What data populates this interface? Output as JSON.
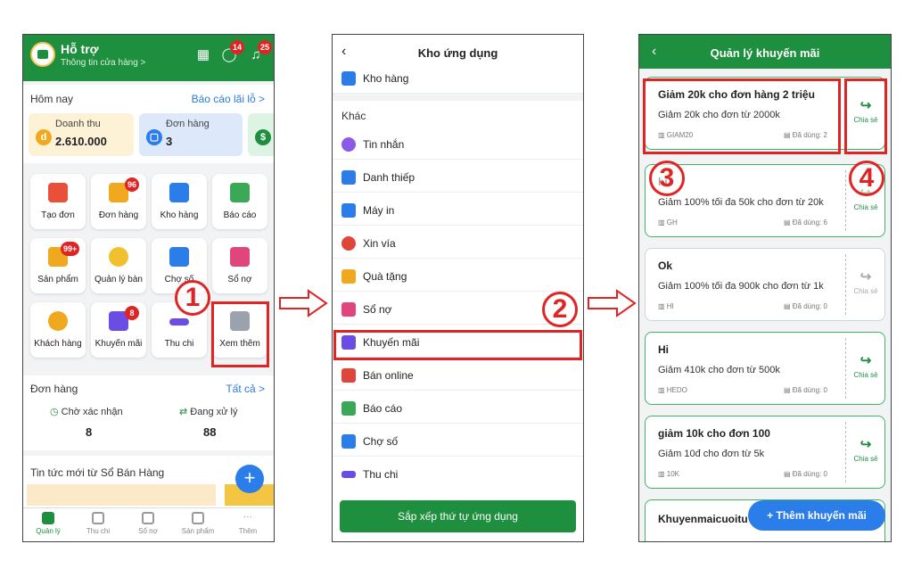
{
  "screen1": {
    "header": {
      "title": "Hỗ trợ",
      "subtitle": "Thông tin cửa hàng >",
      "badge_chat": "14",
      "badge_bell": "25"
    },
    "today": {
      "title": "Hôm nay",
      "report_link": "Báo cáo lãi lỗ >",
      "revenue_label": "Doanh thu",
      "revenue_value": "2.610.000",
      "orders_label": "Đơn hàng",
      "orders_value": "3"
    },
    "tiles": [
      {
        "label": "Tạo đơn",
        "badge": ""
      },
      {
        "label": "Đơn hàng",
        "badge": "96"
      },
      {
        "label": "Kho hàng",
        "badge": ""
      },
      {
        "label": "Báo cáo",
        "badge": ""
      },
      {
        "label": "Sản phẩm",
        "badge": "99+"
      },
      {
        "label": "Quản lý bàn",
        "badge": ""
      },
      {
        "label": "Chợ số",
        "badge": ""
      },
      {
        "label": "Sổ nợ",
        "badge": ""
      },
      {
        "label": "Khách hàng",
        "badge": ""
      },
      {
        "label": "Khuyến mãi",
        "badge": "8"
      },
      {
        "label": "Thu chi",
        "badge": ""
      },
      {
        "label": "Xem thêm",
        "badge": ""
      }
    ],
    "orders": {
      "title": "Đơn hàng",
      "all_link": "Tất cả >",
      "pending_label": "Chờ xác nhận",
      "pending_value": "8",
      "processing_label": "Đang xử lý",
      "processing_value": "88"
    },
    "news": {
      "title": "Tin tức mới từ Sổ Bán Hàng"
    },
    "nav": [
      "Quản lý",
      "Thu chi",
      "Sổ nợ",
      "Sản phẩm",
      "Thêm"
    ]
  },
  "screen2": {
    "title": "Kho ứng dụng",
    "top_item": "Kho hàng",
    "section": "Khác",
    "items": [
      "Tin nhắn",
      "Danh thiếp",
      "Máy in",
      "Xin vía",
      "Quà tặng",
      "Sổ nợ",
      "Khuyến mãi",
      "Bán online",
      "Báo cáo",
      "Chợ số",
      "Thu chi"
    ],
    "button": "Sắp xếp thứ tự ứng dụng"
  },
  "screen3": {
    "title": "Quản lý khuyến mãi",
    "share_label": "Chia sẻ",
    "coupons": [
      {
        "title": "Giảm 20k cho đơn hàng 2 triệu",
        "desc": "Giảm 20k cho đơn từ 2000k",
        "code": "GIAM20",
        "used": "Đã dùng: 2"
      },
      {
        "title": "hi",
        "desc": "Giảm 100% tối đa 50k cho đơn từ 20k",
        "code": "GH",
        "used": "Đã dùng: 6"
      },
      {
        "title": "Ok",
        "desc": "Giảm 100% tối đa 900k cho đơn từ 1k",
        "code": "HI",
        "used": "Đã dùng: 0"
      },
      {
        "title": "Hi",
        "desc": "Giảm 410k cho đơn từ 500k",
        "code": "HEDO",
        "used": "Đã dùng: 0"
      },
      {
        "title": "giảm 10k cho đơn 100",
        "desc": "Giảm 10đ cho đơn từ 5k",
        "code": "10K",
        "used": "Đã dùng: 0"
      },
      {
        "title": "Khuyenmaicuoitu",
        "desc": "",
        "code": "",
        "used": ""
      }
    ],
    "add_button": "+ Thêm khuyến mãi"
  },
  "steps": [
    "1",
    "2",
    "3",
    "4"
  ],
  "colors": {
    "primary_green": "#1e8f3f",
    "highlight_red": "#e02424",
    "fab_blue": "#2b7de9"
  }
}
